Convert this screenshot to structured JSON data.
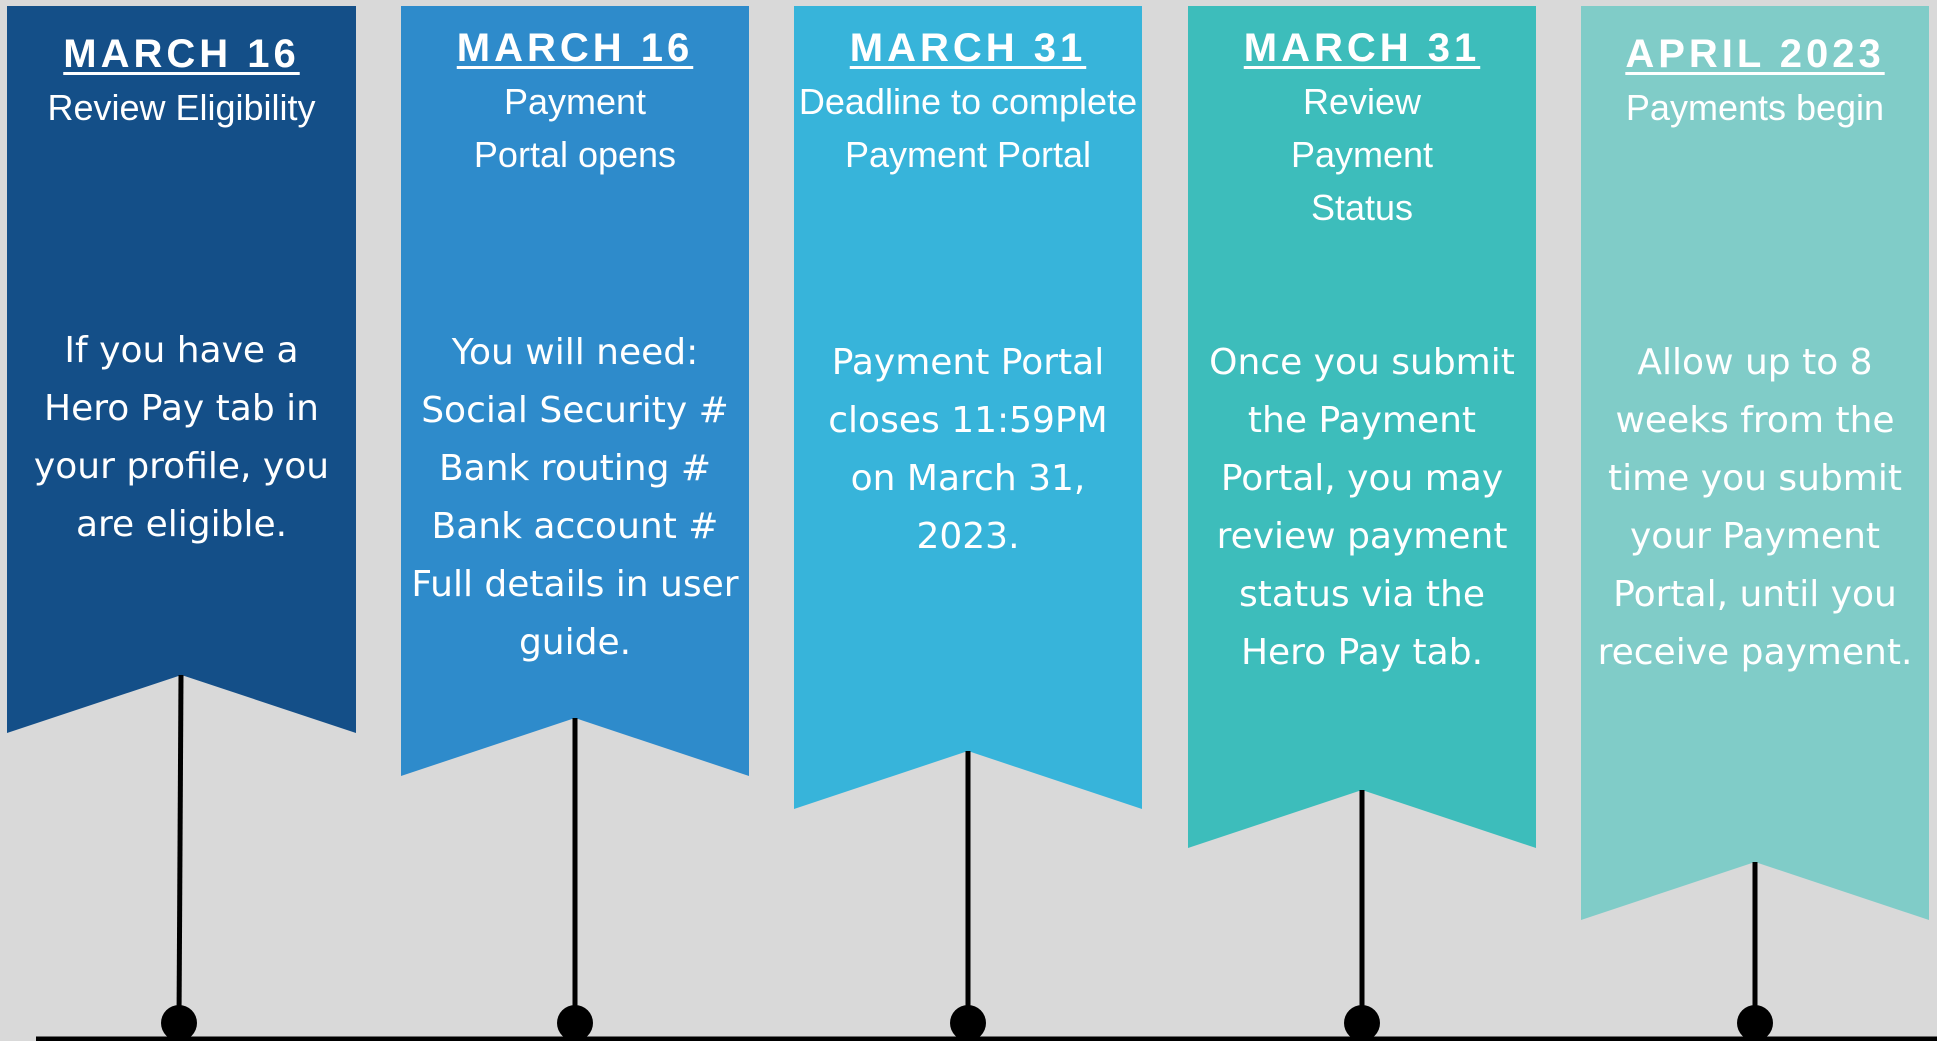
{
  "timeline": {
    "milestones": [
      {
        "date": "MARCH 16",
        "title": "Review Eligibility",
        "description": "If you have a Hero Pay tab in your profile, you are eligible.",
        "color": "#144f88"
      },
      {
        "date": "MARCH 16",
        "title": "Payment Portal opens",
        "description": "You will need: Social Security # Bank routing # Bank account # Full details in user guide.",
        "color": "#2e8bcb"
      },
      {
        "date": "MARCH 31",
        "title": "Deadline to complete Payment Portal",
        "description": "Payment Portal closes 11:59PM on March 31, 2023.",
        "color": "#37b4da"
      },
      {
        "date": "MARCH 31",
        "title": "Review Payment Status",
        "description": "Once you submit the Payment Portal, you may review payment status via the Hero Pay tab.",
        "color": "#3dbdbb"
      },
      {
        "date": "APRIL 2023",
        "title": "Payments begin",
        "description": "Allow up to 8 weeks from the time you submit your Payment Portal, until you receive payment.",
        "color": "#80ccc8"
      }
    ],
    "line_color": "#000000",
    "background": "#d9d9d9"
  }
}
